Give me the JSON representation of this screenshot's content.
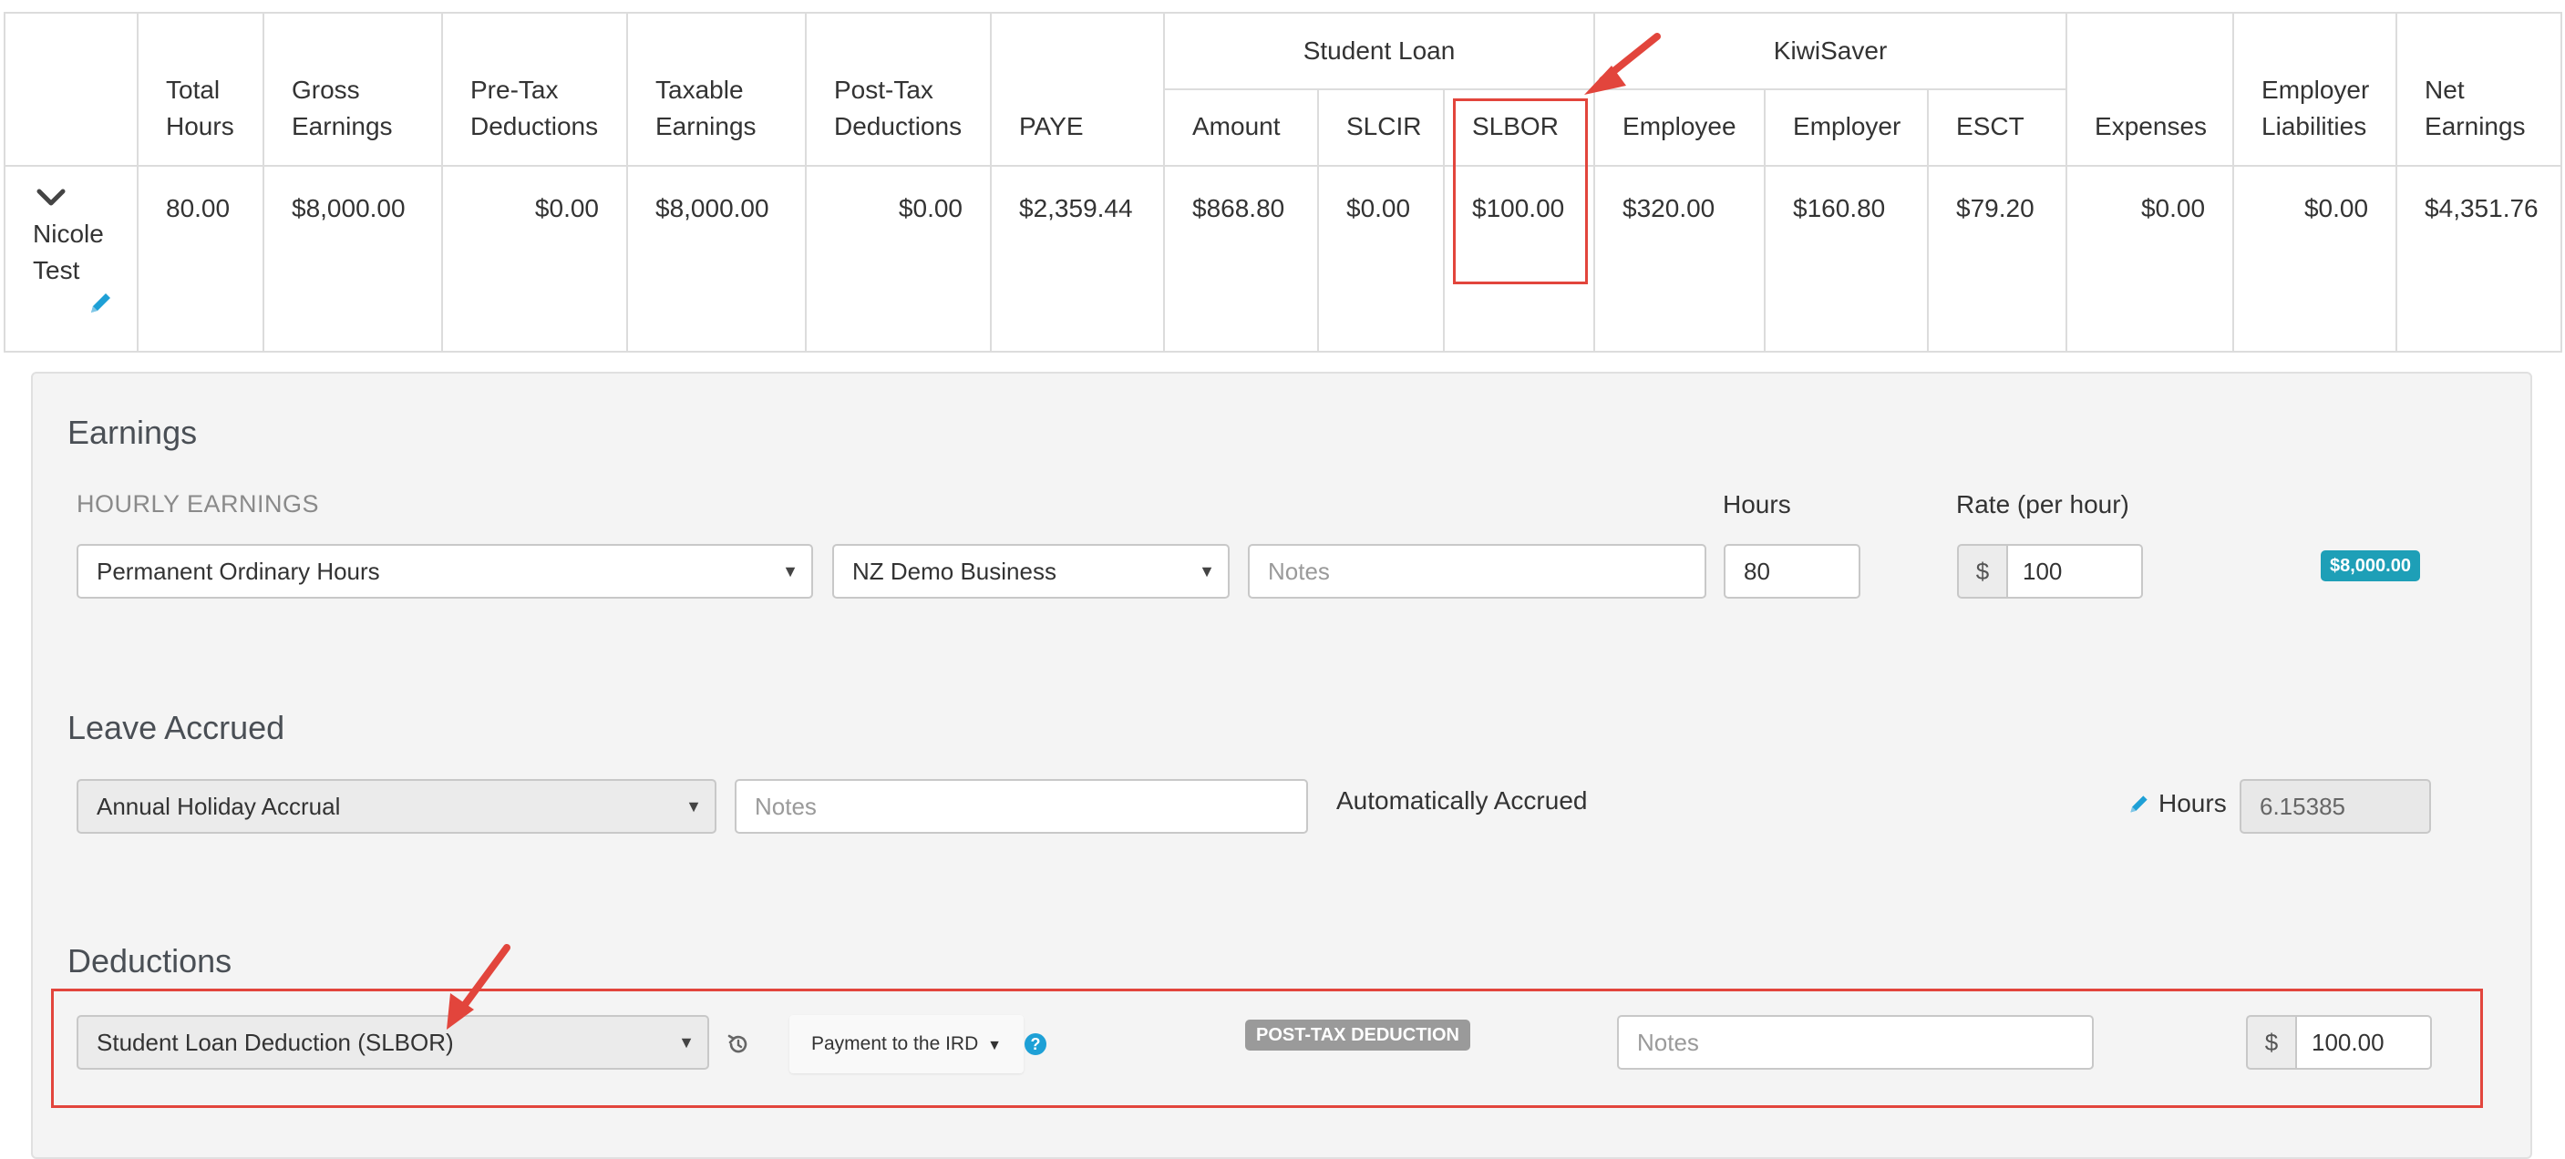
{
  "table": {
    "headers": {
      "total_hours": "Total Hours",
      "gross_earnings": "Gross Earnings",
      "pre_tax_deductions": "Pre-Tax Deductions",
      "taxable_earnings": "Taxable Earnings",
      "post_tax_deductions": "Post-Tax Deductions",
      "paye": "PAYE",
      "student_loan_group": "Student Loan",
      "sl_amount": "Amount",
      "slcir": "SLCIR",
      "slbor": "SLBOR",
      "kiwisaver_group": "KiwiSaver",
      "ks_employee": "Employee",
      "ks_employer": "Employer",
      "esct": "ESCT",
      "expenses": "Expenses",
      "employer_liabilities": "Employer Liabilities",
      "net_earnings": "Net Earnings"
    },
    "row": {
      "employee_name": "Nicole Test",
      "total_hours": "80.00",
      "gross_earnings": "$8,000.00",
      "pre_tax_deductions": "$0.00",
      "taxable_earnings": "$8,000.00",
      "post_tax_deductions": "$0.00",
      "paye": "$2,359.44",
      "sl_amount": "$868.80",
      "slcir": "$0.00",
      "slbor": "$100.00",
      "ks_employee": "$320.00",
      "ks_employer": "$160.80",
      "esct": "$79.20",
      "expenses": "$0.00",
      "employer_liabilities": "$0.00",
      "net_earnings": "$4,351.76"
    }
  },
  "earnings": {
    "title": "Earnings",
    "subheading": "HOURLY EARNINGS",
    "hours_label": "Hours",
    "rate_label": "Rate (per hour)",
    "earning_type": "Permanent Ordinary Hours",
    "business": "NZ Demo Business",
    "notes_placeholder": "Notes",
    "hours_value": "80",
    "currency_symbol": "$",
    "rate_value": "100",
    "total_badge": "$8,000.00"
  },
  "leave": {
    "title": "Leave Accrued",
    "leave_type": "Annual Holiday Accrual",
    "notes_placeholder": "Notes",
    "status_text": "Automatically Accrued",
    "hours_label": "Hours",
    "hours_value": "6.15385"
  },
  "deductions": {
    "title": "Deductions",
    "deduction_type": "Student Loan Deduction (SLBOR)",
    "payment_dropdown": "Payment to the IRD",
    "help_glyph": "?",
    "type_badge": "POST-TAX DEDUCTION",
    "notes_placeholder": "Notes",
    "currency_symbol": "$",
    "amount_value": "100.00"
  },
  "colors": {
    "accent_teal": "#1e9fb7",
    "link_blue": "#1ea0d6",
    "annotation_red": "#e2453c"
  },
  "icons": {
    "row_toggle": "chevron-down-icon",
    "edit": "pencil-icon",
    "reset": "history-icon",
    "help": "question-circle-icon",
    "annotation": "red-arrow"
  }
}
